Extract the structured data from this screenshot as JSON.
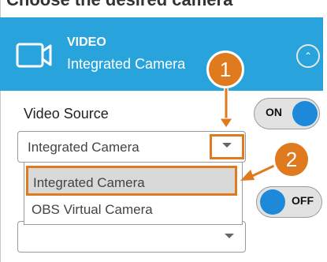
{
  "top_text": "Choose the desired camera",
  "header": {
    "title": "VIDEO",
    "subtitle": "Integrated Camera"
  },
  "video_source": {
    "label": "Video Source",
    "selected": "Integrated Camera",
    "toggle_label": "ON"
  },
  "dropdown": {
    "options": [
      "Integrated Camera",
      "OBS Virtual Camera"
    ]
  },
  "second_toggle": {
    "label": "OFF"
  },
  "callouts": [
    "1",
    "2"
  ],
  "colors": {
    "header": "#29a3dc",
    "accent": "#e07a1f",
    "toggle_knob": "#1e88d9"
  }
}
